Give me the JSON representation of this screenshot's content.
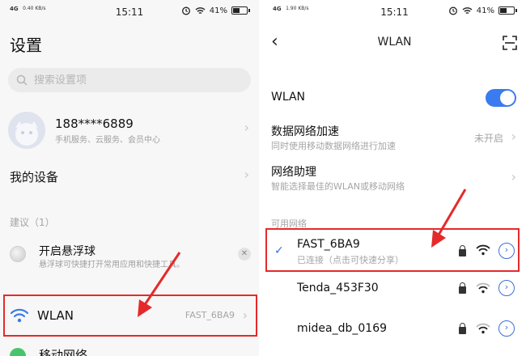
{
  "left": {
    "status": {
      "network": "4G",
      "speed": "0.40 KB/s",
      "time": "15:11",
      "battery": "41%"
    },
    "title": "设置",
    "search": {
      "placeholder": "搜索设置项"
    },
    "account": {
      "name": "188****6889",
      "subtitle": "手机服务、云服务、会员中心"
    },
    "my_devices": "我的设备",
    "suggestion_label": "建议（1）",
    "float_ball": {
      "title": "开启悬浮球",
      "subtitle": "悬浮球可快捷打开常用应用和快捷工具。"
    },
    "wlan": {
      "label": "WLAN",
      "value": "FAST_6BA9"
    },
    "mobile_network": "移动网络"
  },
  "right": {
    "status": {
      "network": "4G",
      "speed": "1.90 KB/s",
      "time": "15:11",
      "battery": "41%"
    },
    "title": "WLAN",
    "wlan_toggle": {
      "label": "WLAN",
      "on": true
    },
    "data_accel": {
      "label": "数据网络加速",
      "subtitle": "同时使用移动数据网络进行加速",
      "value": "未开启"
    },
    "assistant": {
      "label": "网络助理",
      "subtitle": "智能选择最佳的WLAN或移动网络"
    },
    "available_label": "可用网络",
    "networks": [
      {
        "name": "FAST_6BA9",
        "status": "已连接（点击可快速分享）",
        "connected": true
      },
      {
        "name": "Tenda_453F30",
        "status": "",
        "connected": false
      },
      {
        "name": "midea_db_0169",
        "status": "",
        "connected": false
      }
    ]
  },
  "colors": {
    "accent": "#3a7bf0",
    "highlight": "#e52a2a",
    "arrow": "#e52a2a"
  },
  "icons": [
    "search-icon",
    "wifi-icon",
    "lock-icon",
    "info-icon",
    "back-icon",
    "scan-icon",
    "alarm-icon",
    "battery-icon"
  ]
}
